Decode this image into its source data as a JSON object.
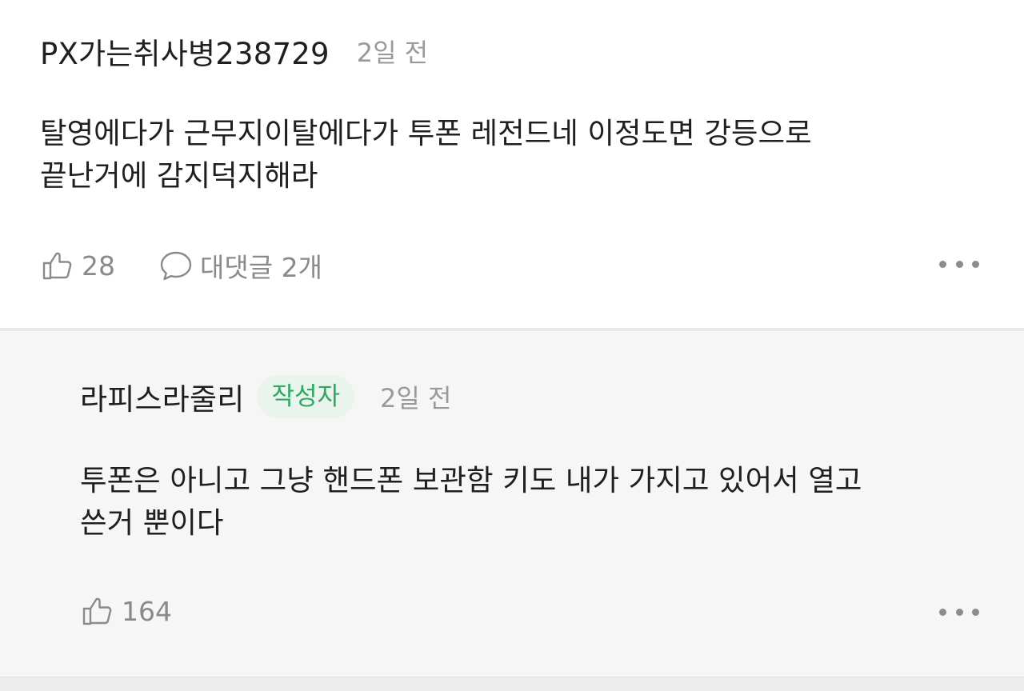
{
  "comments": [
    {
      "author": "PX가는취사병238729",
      "time": "2일 전",
      "text_lines": [
        "탈영에다가 근무지이탈에다가 투폰 레전드네 이정도면 강등으로",
        "끝난거에 감지덕지해라"
      ],
      "likes": "28",
      "replies_label": "대댓글 2개"
    }
  ],
  "reply": {
    "author": "라피스라줄리",
    "badge": "작성자",
    "time": "2일 전",
    "text_lines": [
      "투폰은 아니고 그냥 핸드폰 보관함 키도 내가 가지고 있어서 열고",
      "쓴거 뿐이다"
    ],
    "likes": "164"
  },
  "icons": {
    "like": "thumbs-up-icon",
    "reply": "speech-bubble-icon",
    "more": "more-dots-icon"
  },
  "colors": {
    "badge_bg": "#e8f4ec",
    "badge_text": "#2fa862",
    "reply_bg": "#f6f6f6",
    "meta_text": "#9a9a9a"
  }
}
